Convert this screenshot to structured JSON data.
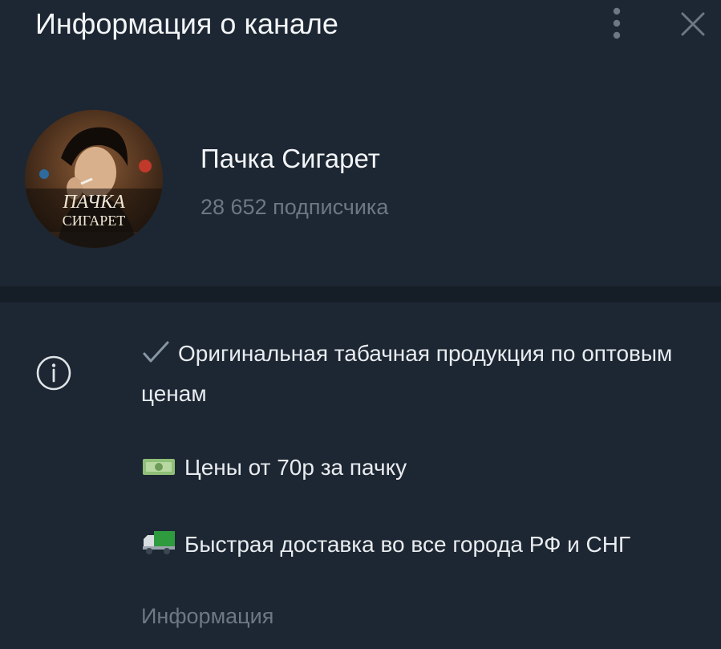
{
  "header": {
    "title": "Информация о канале",
    "more_icon": "more-vertical-icon",
    "close_icon": "close-icon"
  },
  "channel": {
    "name": "Пачка Сигарет",
    "subscribers": "28 652 подписчика",
    "avatar_text_line1": "ПАЧКА",
    "avatar_text_line2": "СИГАРЕТ"
  },
  "info": {
    "icon": "info-icon",
    "lines": [
      {
        "emoji": "check-mark-icon",
        "text": "Оригинальная табачная продукция по оптовым ценам"
      },
      {
        "emoji": "money-icon",
        "text": "Цены от 70р за пачку"
      },
      {
        "emoji": "truck-icon",
        "text": "Быстрая доставка во все города РФ и СНГ"
      }
    ],
    "label": "Информация"
  },
  "colors": {
    "background": "#1d2733",
    "divider": "#151e27",
    "secondary_text": "#6c7883",
    "primary_text": "#f2f4f6"
  }
}
